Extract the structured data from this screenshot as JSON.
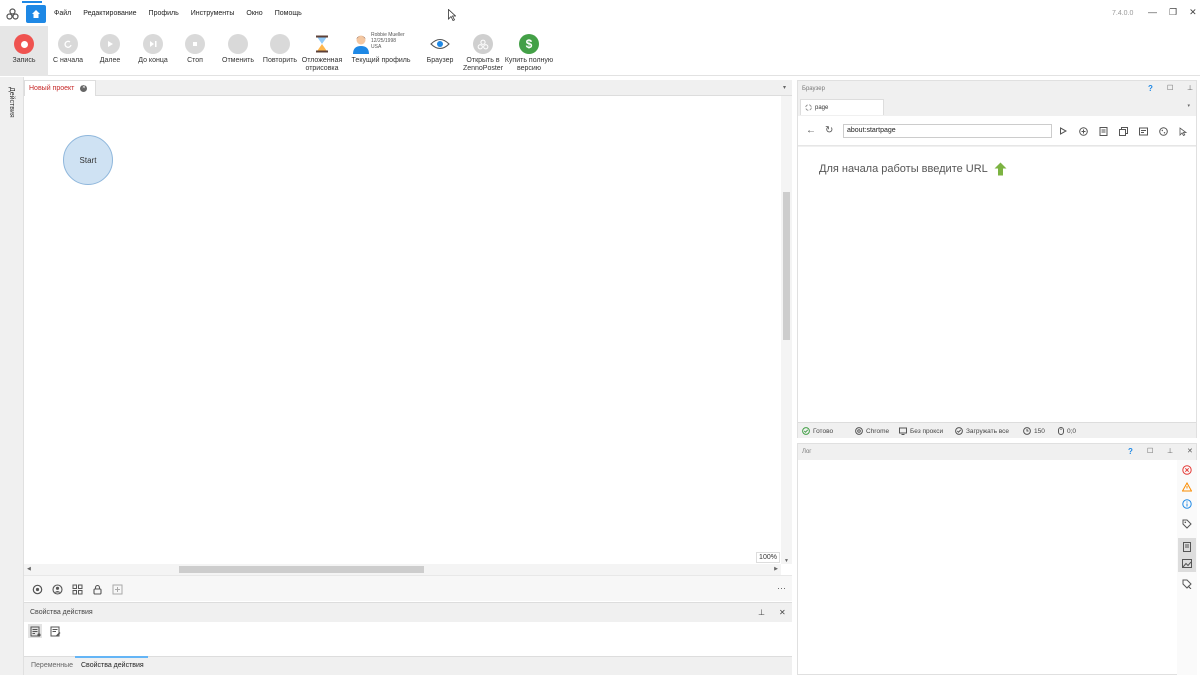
{
  "menu": {
    "items": [
      "Файл",
      "Редактирование",
      "Профиль",
      "Инструменты",
      "Окно",
      "Помощь"
    ],
    "version": "7.4.0.0",
    "window_controls": [
      "—",
      "❐",
      "✕"
    ]
  },
  "toolbar": {
    "record": "Запись",
    "from_start": "С начала",
    "next": "Далее",
    "to_end": "До конца",
    "stop": "Стоп",
    "undo": "Отменить",
    "redo": "Повторить",
    "deferred_line1": "Отложенная",
    "deferred_line2": "отрисовка",
    "current_profile": "Текущий профиль",
    "profile_name": "Robbie Mueller",
    "profile_date": "12/25/1998",
    "profile_country": "USA",
    "browser": "Браузер",
    "open_zp_line1": "Открыть в",
    "open_zp_line2": "ZennoPoster",
    "buy_line1": "Купить полную",
    "buy_line2": "версию"
  },
  "left_strip": {
    "label": "Действия"
  },
  "project": {
    "tab_title": "Новый проект",
    "start_node": "Start",
    "zoom": "100%"
  },
  "props": {
    "title": "Свойства действия",
    "pin": "⊥",
    "close": "✕",
    "tabs": [
      "Переменные",
      "Свойства действия"
    ]
  },
  "browser_panel": {
    "title": "Браузер",
    "help": "?",
    "tab": "page",
    "url": "about:startpage",
    "start_message": "Для начала работы введите URL",
    "status": {
      "ready": "Готово",
      "engine": "Chrome",
      "proxy": "Без прокси",
      "load": "Загружать все",
      "timeout": "150",
      "coords": "0;0"
    }
  },
  "log_panel": {
    "title": "Лог",
    "help": "?"
  },
  "colors": {
    "accent": "#1e88e5",
    "record": "#ef5350",
    "buy": "#43a047",
    "start_node_fill": "#cfe2f3",
    "tab_title": "#c62828"
  }
}
